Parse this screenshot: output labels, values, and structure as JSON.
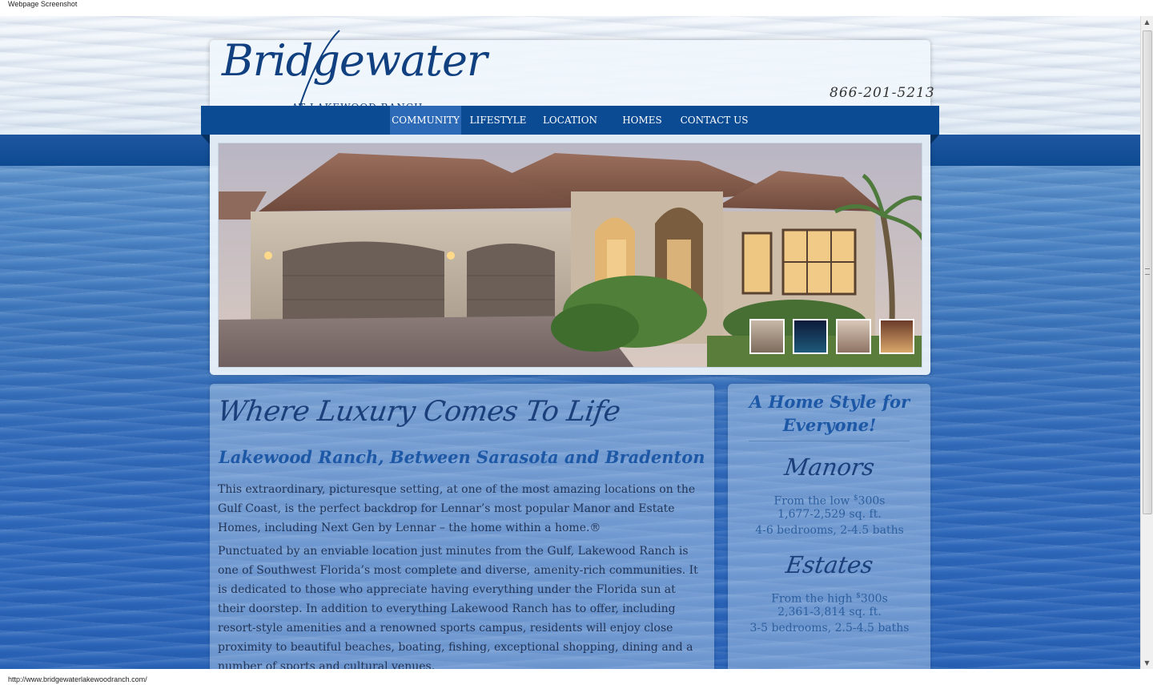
{
  "window": {
    "caption": "Webpage Screenshot",
    "status_url": "http://www.bridgewaterlakewoodranch.com/"
  },
  "header": {
    "logo_main": "Bridgewater",
    "logo_sub": "AT LAKEWOOD RANCH",
    "phone": "866-201-5213"
  },
  "nav": {
    "items": [
      {
        "label": "COMMUNITY",
        "active": true
      },
      {
        "label": "LIFESTYLE",
        "active": false
      },
      {
        "label": "LOCATION",
        "active": false
      },
      {
        "label": "HOMES",
        "active": false
      },
      {
        "label": "CONTACT US",
        "active": false
      }
    ]
  },
  "hero": {
    "thumbnails": [
      "home-exterior-thumb",
      "pool-night-thumb",
      "interior-thumb",
      "lanai-thumb"
    ]
  },
  "main": {
    "tagline": "Where Luxury Comes To Life",
    "subhead": "Lakewood Ranch, Between Sarasota and Bradenton",
    "paragraphs": [
      "This extraordinary, picturesque setting, at one of the most amazing locations on the Gulf Coast, is the perfect backdrop for Lennar’s most popular Manor and Estate Homes, including Next Gen by Lennar – the home within a home.®",
      "Punctuated by an enviable location just minutes from the Gulf, Lakewood Ranch is one of Southwest Florida’s most complete and diverse, amenity-rich communities. It is dedicated to those who appreciate having everything under the Florida sun at their doorstep. In addition to everything Lakewood Ranch has to offer, including resort-style amenities and a renowned sports campus, residents will enjoy close proximity to beautiful beaches, boating, fishing, exceptional shopping, dining and a number of sports and cultural venues."
    ]
  },
  "sidebar": {
    "title": "A Home Style for Everyone!",
    "sections": [
      {
        "heading": "Manors",
        "price_prefix": "From the low",
        "price_sup": "$",
        "price": "300s",
        "sqft": "1,677-2,529 sq. ft.",
        "rooms": "4-6 bedrooms, 2-4.5 baths"
      },
      {
        "heading": "Estates",
        "price_prefix": "From the high",
        "price_sup": "$",
        "price": "300s",
        "sqft": "2,361-3,814 sq. ft.",
        "rooms": "3-5 bedrooms, 2.5-4.5 baths"
      }
    ]
  },
  "colors": {
    "brand_navy": "#0a4b93",
    "nav_active": "#2c6ab8",
    "heading_blue": "#1d58a7",
    "text": "#223456"
  }
}
